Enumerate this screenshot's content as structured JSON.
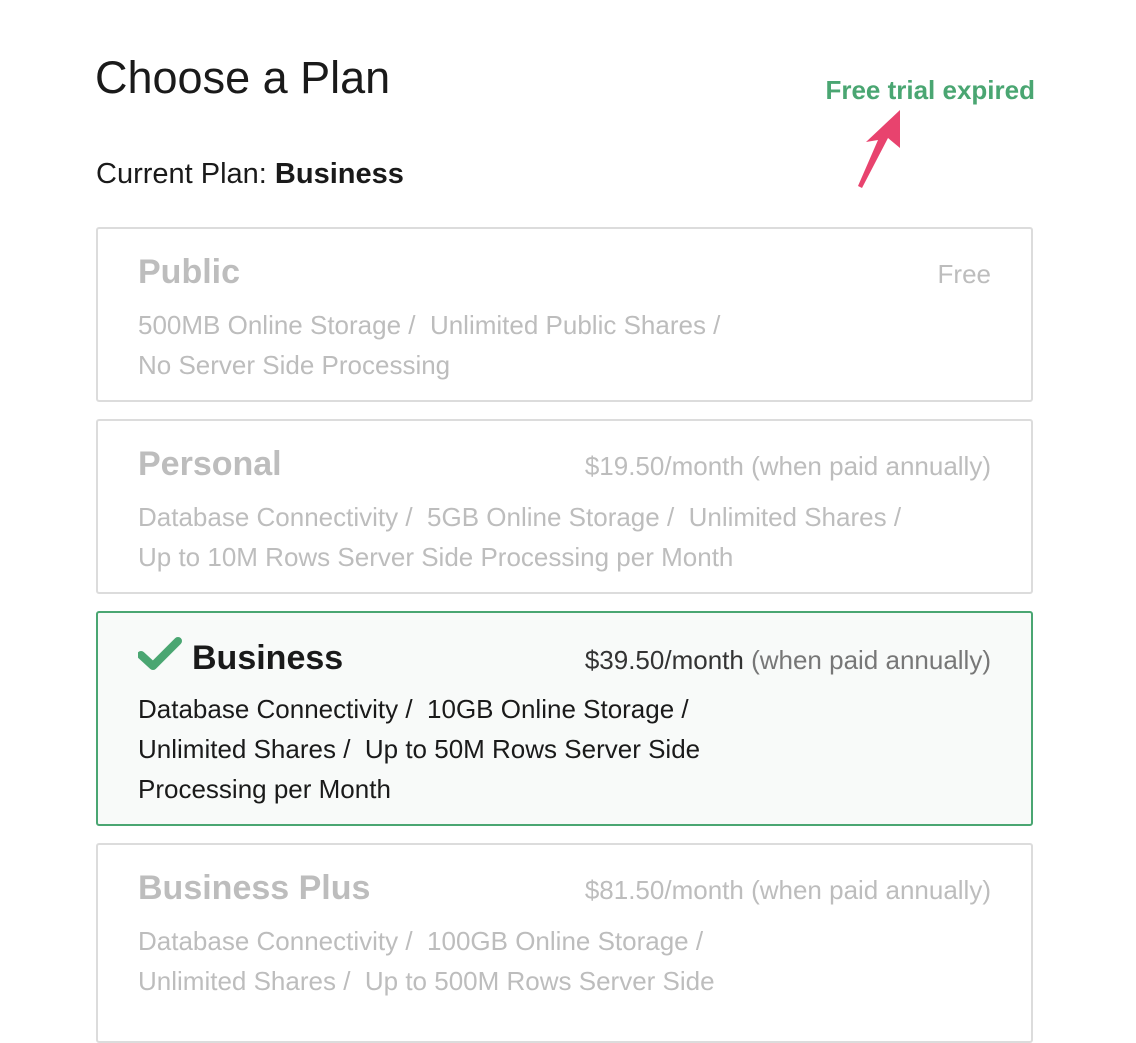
{
  "header": {
    "title": "Choose a Plan",
    "trial_status": "Free trial expired",
    "current_label": "Current Plan:",
    "current_value": "Business"
  },
  "colors": {
    "accent": "#4aa672",
    "arrow": "#e8436e"
  },
  "plans": [
    {
      "name": "Public",
      "price": "Free",
      "price_note": "",
      "lines": [
        "500MB Online Storage /  Unlimited Public Shares /",
        "No Server Side Processing"
      ]
    },
    {
      "name": "Personal",
      "price": "$19.50/month",
      "price_note": " (when paid annually)",
      "lines": [
        "Database Connectivity /  5GB Online Storage /  Unlimited Shares /",
        "Up to 10M Rows Server Side Processing per Month"
      ]
    },
    {
      "name": "Business",
      "price": "$39.50/month",
      "price_note": " (when paid annually)",
      "lines": [
        "Database Connectivity /  10GB Online Storage /",
        "Unlimited Shares /  Up to 50M Rows Server Side",
        "Processing per Month"
      ]
    },
    {
      "name": "Business Plus",
      "price": "$81.50/month",
      "price_note": " (when paid annually)",
      "lines": [
        "Database Connectivity /  100GB Online Storage /",
        "Unlimited Shares /  Up to 500M Rows Server Side"
      ]
    }
  ]
}
